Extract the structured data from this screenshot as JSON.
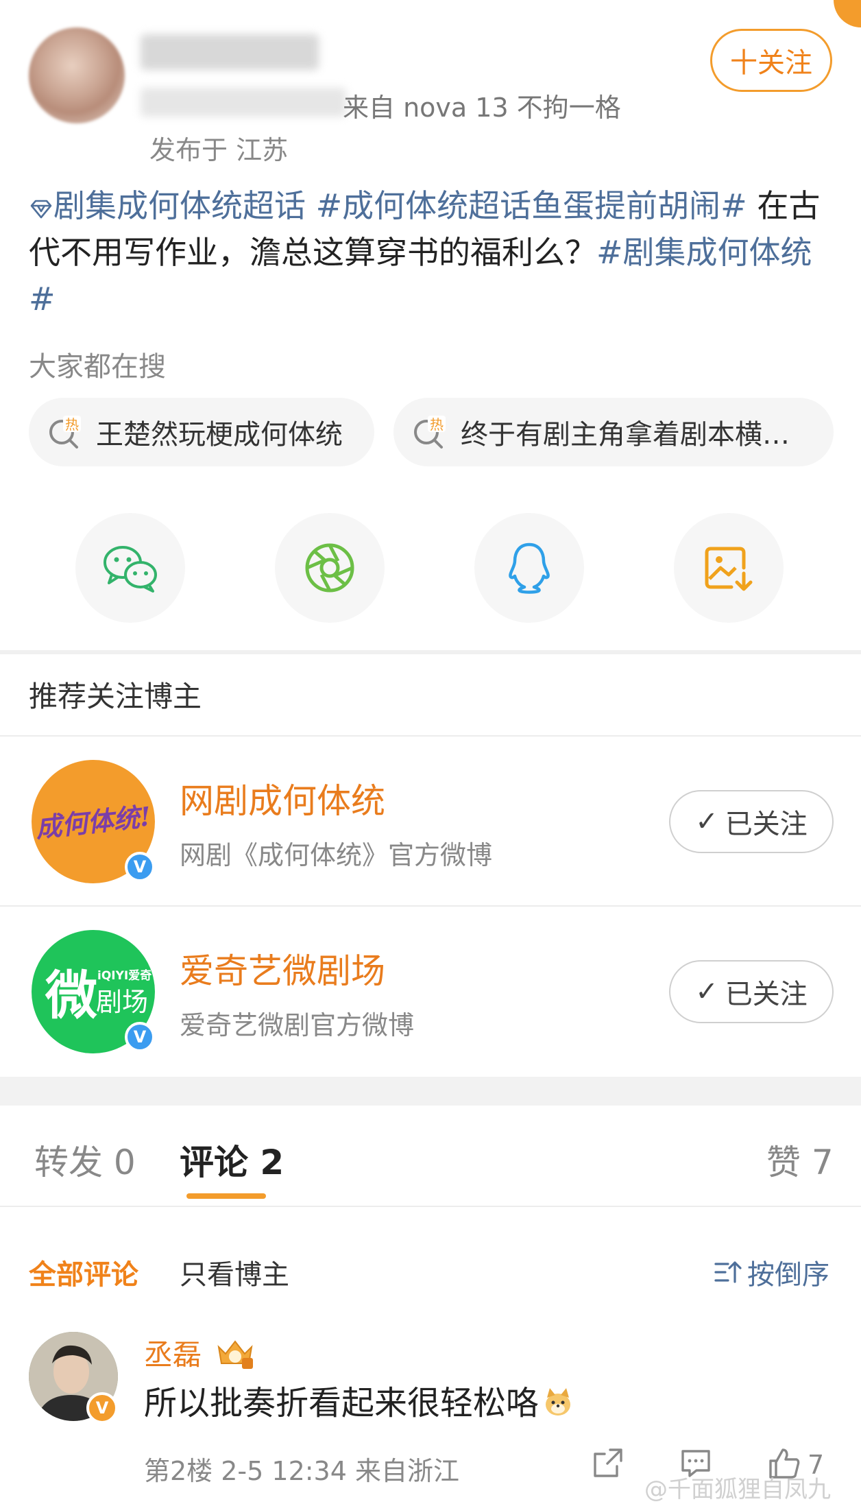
{
  "header": {
    "meta_source": "来自 nova 13 不拘一格",
    "location": "发布于 江苏",
    "follow_label": "十关注"
  },
  "post": {
    "super_topic": "剧集成何体统超话",
    "tag1": "#成何体统超话鱼蛋提前胡闹#",
    "text": "在古代不用写作业，澹总这算穿书的福利么？",
    "tag2": "#剧集成何体统#"
  },
  "search": {
    "title": "大家都在搜",
    "chips": [
      {
        "label": "王楚然玩梗成何体统",
        "badge": "热"
      },
      {
        "label": "终于有剧主角拿着剧本横…",
        "badge": "热"
      }
    ]
  },
  "share": {
    "icons": [
      "wechat-icon",
      "moments-icon",
      "qq-icon",
      "save-image-icon"
    ]
  },
  "recommend": {
    "title": "推荐关注博主",
    "accounts": [
      {
        "name": "网剧成何体统",
        "desc": "网剧《成何体统》官方微博",
        "button": "已关注",
        "avatar_text": "成何体统!",
        "avatar_color": "#f39c2c"
      },
      {
        "name": "爱奇艺微剧场",
        "desc": "爱奇艺微剧官方微博",
        "button": "已关注",
        "avatar_text_big": "微",
        "avatar_text_small": "剧场",
        "avatar_brand": "iQIYI爱奇艺",
        "avatar_color": "#1fc45a"
      }
    ]
  },
  "tabs": {
    "repost": "转发 0",
    "comments": "评论 2",
    "likes": "赞 7"
  },
  "filters": {
    "all": "全部评论",
    "author_only": "只看博主",
    "sort": "按倒序"
  },
  "comment": {
    "user": "丞磊",
    "text": "所以批奏折看起来很轻松咯",
    "meta": "第2楼 2-5 12:34 来自浙江",
    "like_count": "7"
  },
  "watermark": "@千面狐狸自凤九",
  "colors": {
    "accent": "#f39c2c",
    "link": "#4e6f9a",
    "name": "#e97c1d"
  }
}
